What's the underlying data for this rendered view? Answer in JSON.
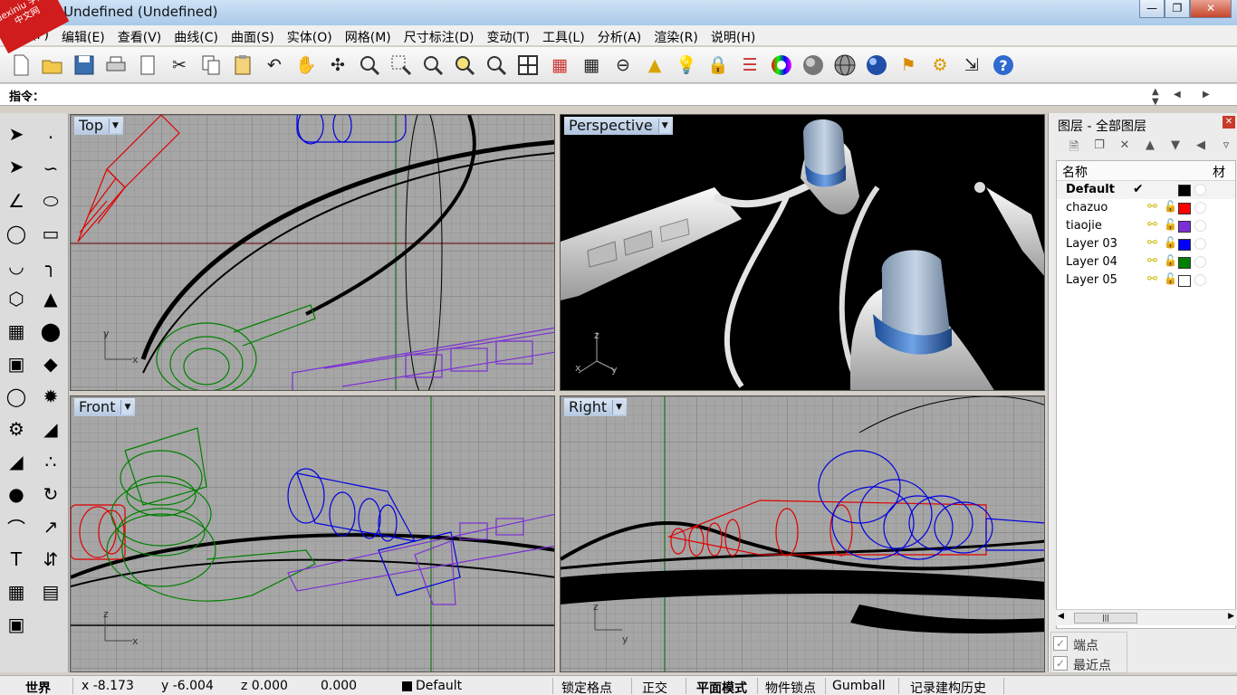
{
  "window": {
    "title": "- Undefined (Undefined)",
    "logo_text": "xuexiniu 学犀牛中文网",
    "min": "",
    "max": "",
    "close": "✕"
  },
  "menu": [
    "(F)",
    "编辑(E)",
    "查看(V)",
    "曲线(C)",
    "曲面(S)",
    "实体(O)",
    "网格(M)",
    "尺寸标注(D)",
    "变动(T)",
    "工具(L)",
    "分析(A)",
    "渲染(R)",
    "说明(H)"
  ],
  "command": {
    "label": "指令：",
    "value": ""
  },
  "viewports": {
    "top": {
      "label": "Top"
    },
    "perspective": {
      "label": "Perspective"
    },
    "front": {
      "label": "Front"
    },
    "right": {
      "label": "Right"
    }
  },
  "layers_panel": {
    "title": "图层 - 全部图层",
    "col_name": "名称",
    "col_material": "材质",
    "layers": [
      {
        "name": "Default",
        "color": "#000000",
        "current": true,
        "check": "✔"
      },
      {
        "name": "chazuo",
        "color": "#ff0000",
        "current": false,
        "check": ""
      },
      {
        "name": "tiaojie",
        "color": "#7b2fd6",
        "current": false,
        "check": ""
      },
      {
        "name": "Layer 03",
        "color": "#0000ff",
        "current": false,
        "check": ""
      },
      {
        "name": "Layer 04",
        "color": "#008000",
        "current": false,
        "check": ""
      },
      {
        "name": "Layer 05",
        "color": "#ffffff",
        "current": false,
        "check": ""
      }
    ]
  },
  "osnap": {
    "end": "端点",
    "near": "最近点"
  },
  "status": {
    "cplane": "世界",
    "x": "x -8.173",
    "y": "y -6.004",
    "z": "z 0.000",
    "dist": "0.000",
    "layer": "Default",
    "grid_snap": "锁定格点",
    "ortho": "正交",
    "planar": "平面模式",
    "osnap": "物件锁点",
    "gumball": "Gumball",
    "history": "记录建构历史"
  }
}
